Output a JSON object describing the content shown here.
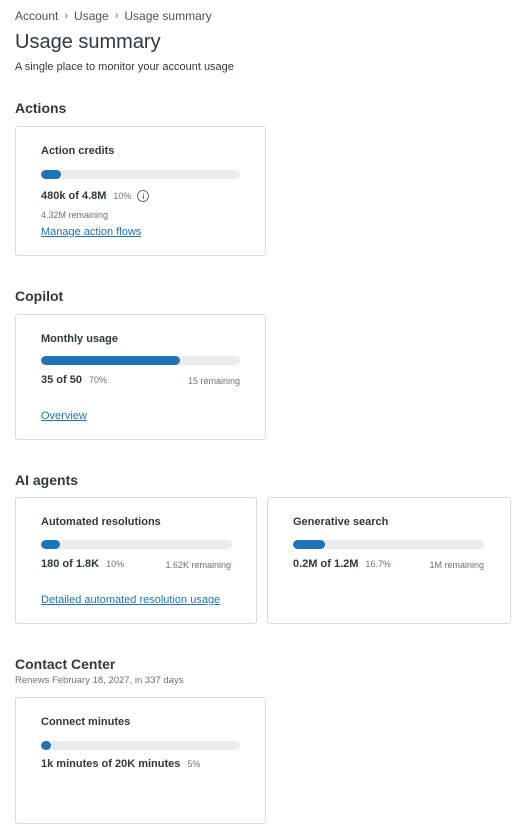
{
  "breadcrumb": {
    "items": [
      "Account",
      "Usage",
      "Usage summary"
    ],
    "separator": ">"
  },
  "page": {
    "title": "Usage summary",
    "subtitle": "A single place to monitor your account usage"
  },
  "colors": {
    "accent": "#1f73b7",
    "track": "#e9ebed",
    "text": "#2f3941",
    "muted": "#68737d",
    "border": "#d8dcde"
  },
  "sections": {
    "actions": {
      "title": "Actions",
      "card": {
        "title": "Action credits",
        "usage": "480k of 4.8M",
        "percent_label": "10%",
        "progress": 0.1,
        "info_icon": "info-icon",
        "remaining": "4.32M remaining",
        "link": "Manage action flows"
      }
    },
    "copilot": {
      "title": "Copilot",
      "card": {
        "title": "Monthly usage",
        "usage": "35 of 50",
        "percent_label": "70%",
        "progress": 0.7,
        "remaining": "15 remaining",
        "link": "Overview"
      }
    },
    "ai_agents": {
      "title": "AI agents",
      "cards": [
        {
          "title": "Automated resolutions",
          "usage": "180 of 1.8K",
          "percent_label": "10%",
          "progress": 0.1,
          "remaining": "1.62K remaining",
          "link": "Detailed automated resolution usage"
        },
        {
          "title": "Generative search",
          "usage": "0.2M of 1.2M",
          "percent_label": "16.7%",
          "progress": 0.167,
          "remaining": "1M remaining"
        }
      ]
    },
    "contact_center": {
      "title": "Contact Center",
      "subtitle": "Renews February 18, 2027, in 337 days",
      "card": {
        "title": "Connect minutes",
        "usage": "1k minutes of 20K minutes",
        "percent_label": "5%",
        "progress": 0.05
      }
    }
  }
}
